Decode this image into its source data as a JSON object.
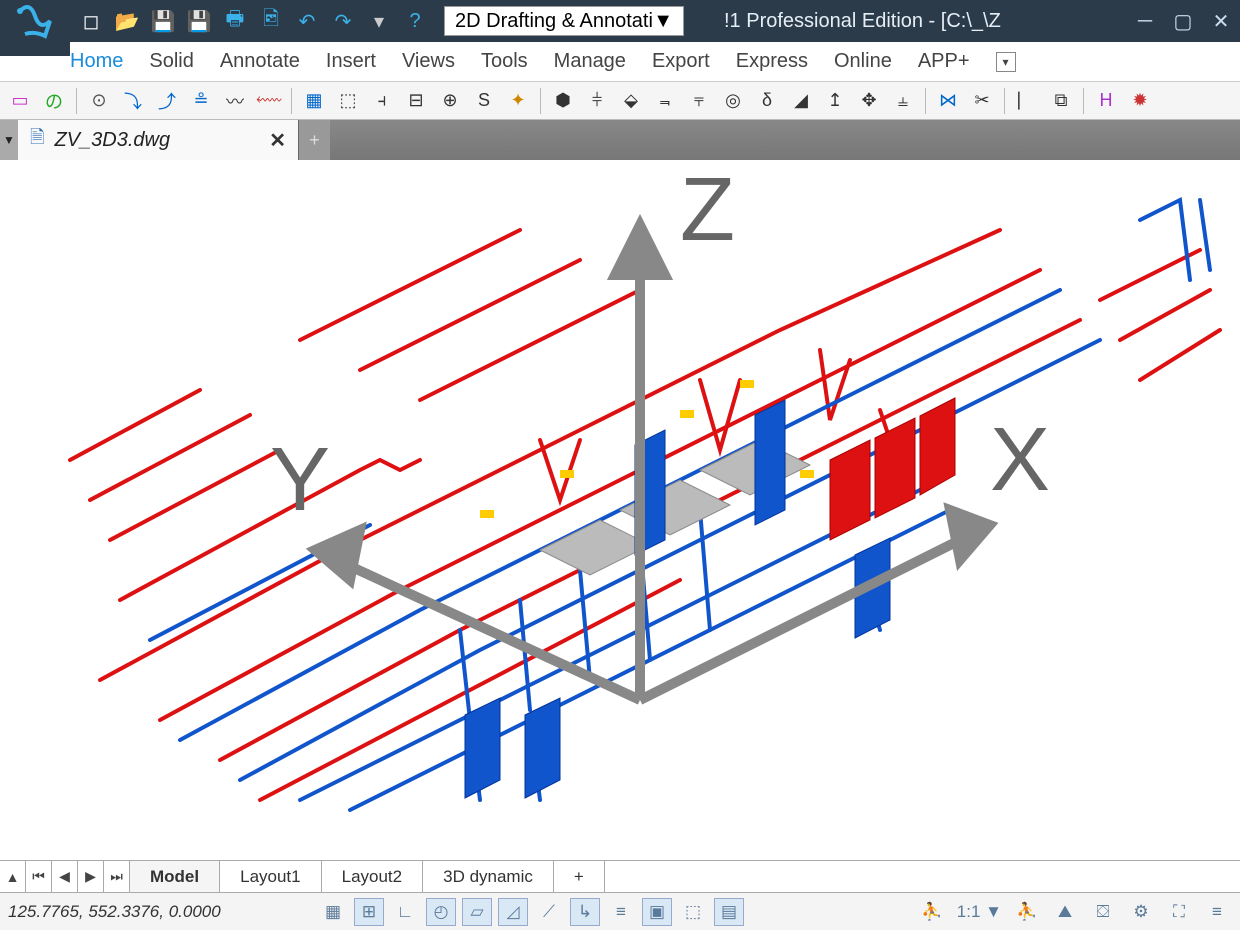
{
  "title": "!1 Professional Edition - [C:\\_\\Z",
  "workspace": {
    "selected": "2D Drafting & Annotati"
  },
  "menubar": [
    "Home",
    "Solid",
    "Annotate",
    "Insert",
    "Views",
    "Tools",
    "Manage",
    "Export",
    "Express",
    "Online",
    "APP+"
  ],
  "menubar_active": 0,
  "qat": [
    {
      "name": "new-icon",
      "glyph": "◻",
      "color": "#fff"
    },
    {
      "name": "open-icon",
      "glyph": "📂",
      "color": "#f5a623"
    },
    {
      "name": "save-icon",
      "glyph": "💾",
      "color": "#3ab1e8"
    },
    {
      "name": "saveall-icon",
      "glyph": "💾",
      "color": "#3ab1e8"
    },
    {
      "name": "print-icon",
      "glyph": "🖶",
      "color": "#3ab1e8"
    },
    {
      "name": "preview-icon",
      "glyph": "🖻",
      "color": "#3ab1e8"
    },
    {
      "name": "undo-icon",
      "glyph": "↶",
      "color": "#3ab1e8"
    },
    {
      "name": "redo-icon",
      "glyph": "↷",
      "color": "#3ab1e8"
    },
    {
      "name": "more-icon",
      "glyph": "▾",
      "color": "#ccc"
    },
    {
      "name": "help-icon",
      "glyph": "?",
      "color": "#3ab1e8"
    }
  ],
  "document": {
    "filename": "ZV_3D3.dwg"
  },
  "toolbar": [
    {
      "n": "rectangle",
      "g": "▭",
      "c": "#c3c"
    },
    {
      "n": "polyline",
      "g": "の",
      "c": "#2a2"
    },
    {
      "n": "sep"
    },
    {
      "n": "circle",
      "g": "⊙",
      "c": "#555"
    },
    {
      "n": "arc-down",
      "g": "⤵",
      "c": "#06c"
    },
    {
      "n": "arc-up",
      "g": "⤴",
      "c": "#06c"
    },
    {
      "n": "offset",
      "g": "≗",
      "c": "#06c"
    },
    {
      "n": "wave",
      "g": "〰",
      "c": "#333"
    },
    {
      "n": "pline",
      "g": "⬳",
      "c": "#c33"
    },
    {
      "n": "sep"
    },
    {
      "n": "table",
      "g": "▦",
      "c": "#06c"
    },
    {
      "n": "insert",
      "g": "⬚",
      "c": "#333"
    },
    {
      "n": "dim-lin",
      "g": "⫞",
      "c": "#333"
    },
    {
      "n": "dim-align",
      "g": "⊟",
      "c": "#333"
    },
    {
      "n": "center",
      "g": "⊕",
      "c": "#333"
    },
    {
      "n": "spline",
      "g": "S",
      "c": "#333"
    },
    {
      "n": "hatch",
      "g": "✦",
      "c": "#c80"
    },
    {
      "n": "sep"
    },
    {
      "n": "box3d",
      "g": "⬢",
      "c": "#333"
    },
    {
      "n": "extrude",
      "g": "⫩",
      "c": "#333"
    },
    {
      "n": "sweep",
      "g": "⬙",
      "c": "#333"
    },
    {
      "n": "array",
      "g": "⫬",
      "c": "#333"
    },
    {
      "n": "align",
      "g": "⫧",
      "c": "#333"
    },
    {
      "n": "ring",
      "g": "◎",
      "c": "#333"
    },
    {
      "n": "break",
      "g": "δ",
      "c": "#333"
    },
    {
      "n": "chamfer",
      "g": "◢",
      "c": "#333"
    },
    {
      "n": "move",
      "g": "↥",
      "c": "#333"
    },
    {
      "n": "scale",
      "g": "✥",
      "c": "#333"
    },
    {
      "n": "stretch",
      "g": "⫨",
      "c": "#333"
    },
    {
      "n": "sep"
    },
    {
      "n": "valve",
      "g": "⋈",
      "c": "#06c"
    },
    {
      "n": "trim",
      "g": "✂",
      "c": "#333"
    },
    {
      "n": "sep"
    },
    {
      "n": "pipe",
      "g": "⎸",
      "c": "#333"
    },
    {
      "n": "grid",
      "g": "⧉",
      "c": "#333"
    },
    {
      "n": "sep"
    },
    {
      "n": "h-tool",
      "g": "H",
      "c": "#a3c"
    },
    {
      "n": "sun",
      "g": "✹",
      "c": "#c33"
    }
  ],
  "layout_tabs": [
    "Model",
    "Layout1",
    "Layout2",
    "3D dynamic"
  ],
  "layout_active": 0,
  "layout_add": "+",
  "statusbar": {
    "coords": "125.7765, 552.3376, 0.0000",
    "buttons": [
      {
        "n": "grid",
        "g": "▦",
        "on": false
      },
      {
        "n": "snap",
        "g": "⊞",
        "on": true
      },
      {
        "n": "ortho",
        "g": "∟",
        "on": false
      },
      {
        "n": "polar",
        "g": "◴",
        "on": true
      },
      {
        "n": "iso",
        "g": "▱",
        "on": true
      },
      {
        "n": "osnap",
        "g": "◿",
        "on": true
      },
      {
        "n": "otrack",
        "g": "⟋",
        "on": false
      },
      {
        "n": "ducs",
        "g": "↳",
        "on": true
      },
      {
        "n": "dyn",
        "g": "≡",
        "on": false
      },
      {
        "n": "lwt",
        "g": "▣",
        "on": true
      },
      {
        "n": "trans",
        "g": "⬚",
        "on": false
      },
      {
        "n": "qprop",
        "g": "▤",
        "on": true
      }
    ],
    "scale": "1:1",
    "right_buttons": [
      {
        "n": "person",
        "g": "⛹"
      },
      {
        "n": "walk",
        "g": "⛰"
      },
      {
        "n": "nav",
        "g": "⛋"
      },
      {
        "n": "gear",
        "g": "⚙"
      },
      {
        "n": "fullscreen",
        "g": "⛶"
      },
      {
        "n": "menu",
        "g": "≡"
      }
    ]
  },
  "ucs_axes": {
    "x": "X",
    "y": "Y",
    "z": "Z"
  }
}
